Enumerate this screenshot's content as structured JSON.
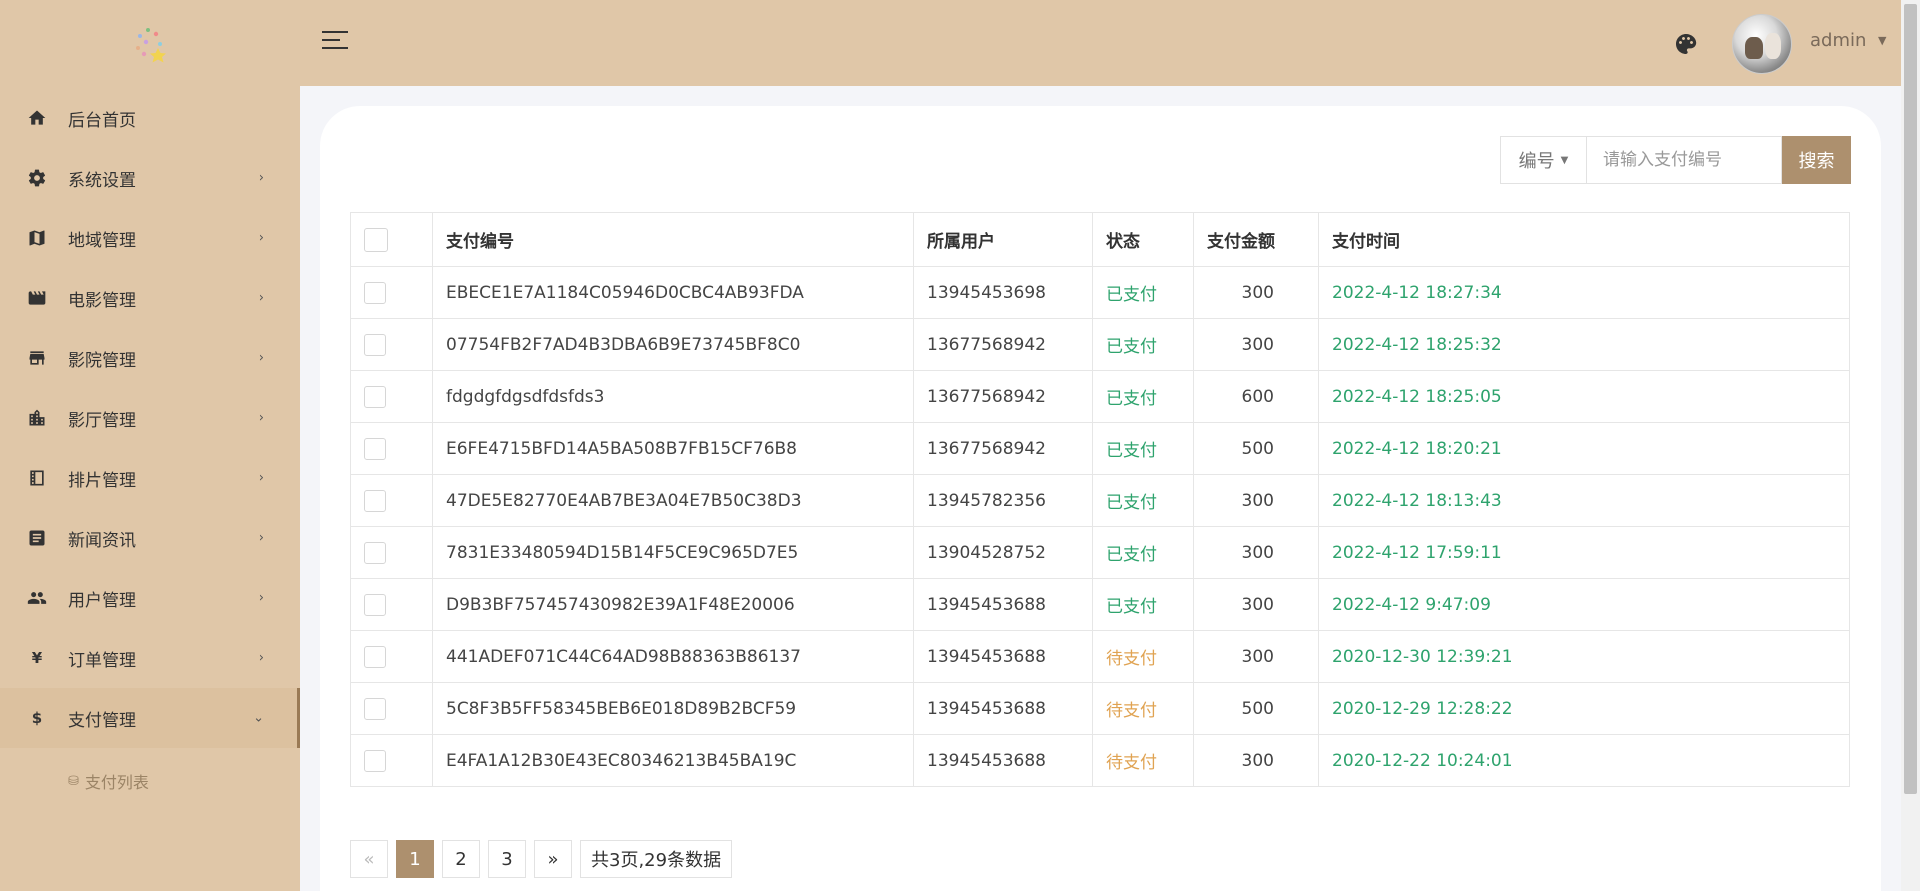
{
  "sidebar": {
    "items": [
      {
        "label": "后台首页",
        "icon": "home-icon",
        "has_children": false
      },
      {
        "label": "系统设置",
        "icon": "gear-icon",
        "has_children": true
      },
      {
        "label": "地域管理",
        "icon": "map-icon",
        "has_children": true
      },
      {
        "label": "电影管理",
        "icon": "film-icon",
        "has_children": true
      },
      {
        "label": "影院管理",
        "icon": "store-icon",
        "has_children": true
      },
      {
        "label": "影厅管理",
        "icon": "building-icon",
        "has_children": true
      },
      {
        "label": "排片管理",
        "icon": "schedule-icon",
        "has_children": true
      },
      {
        "label": "新闻资讯",
        "icon": "news-icon",
        "has_children": true
      },
      {
        "label": "用户管理",
        "icon": "users-icon",
        "has_children": true
      },
      {
        "label": "订单管理",
        "icon": "yen-icon",
        "has_children": true
      },
      {
        "label": "支付管理",
        "icon": "dollar-icon",
        "has_children": true,
        "expanded": true
      }
    ],
    "sub_items": [
      {
        "label": "支付列表",
        "icon": "database-icon"
      }
    ]
  },
  "header": {
    "user_name": "admin",
    "icons": [
      "hamburger-icon",
      "palette-icon"
    ]
  },
  "search": {
    "field_select": "编号",
    "placeholder": "请输入支付编号",
    "button_label": "搜索"
  },
  "table": {
    "columns": [
      "支付编号",
      "所属用户",
      "状态",
      "支付金额",
      "支付时间"
    ],
    "rows": [
      {
        "id": "EBECE1E7A1184C05946D0CBC4AB93FDA",
        "user": "13945453698",
        "status": "已支付",
        "amount": "300",
        "time": "2022-4-12 18:27:34"
      },
      {
        "id": "07754FB2F7AD4B3DBA6B9E73745BF8C0",
        "user": "13677568942",
        "status": "已支付",
        "amount": "300",
        "time": "2022-4-12 18:25:32"
      },
      {
        "id": "fdgdgfdgsdfdsfds3",
        "user": "13677568942",
        "status": "已支付",
        "amount": "600",
        "time": "2022-4-12 18:25:05"
      },
      {
        "id": "E6FE4715BFD14A5BA508B7FB15CF76B8",
        "user": "13677568942",
        "status": "已支付",
        "amount": "500",
        "time": "2022-4-12 18:20:21"
      },
      {
        "id": "47DE5E82770E4AB7BE3A04E7B50C38D3",
        "user": "13945782356",
        "status": "已支付",
        "amount": "300",
        "time": "2022-4-12 18:13:43"
      },
      {
        "id": "7831E33480594D15B14F5CE9C965D7E5",
        "user": "13904528752",
        "status": "已支付",
        "amount": "300",
        "time": "2022-4-12 17:59:11"
      },
      {
        "id": "D9B3BF757457430982E39A1F48E20006",
        "user": "13945453688",
        "status": "已支付",
        "amount": "300",
        "time": "2022-4-12 9:47:09"
      },
      {
        "id": "441ADEF071C44C64AD98B88363B86137",
        "user": "13945453688",
        "status": "待支付",
        "amount": "300",
        "time": "2020-12-30 12:39:21"
      },
      {
        "id": "5C8F3B5FF58345BEB6E018D89B2BCF59",
        "user": "13945453688",
        "status": "待支付",
        "amount": "500",
        "time": "2020-12-29 12:28:22"
      },
      {
        "id": "E4FA1A12B30E43EC80346213B45BA19C",
        "user": "13945453688",
        "status": "待支付",
        "amount": "300",
        "time": "2020-12-22 10:24:01"
      }
    ]
  },
  "pagination": {
    "prev": "«",
    "pages": [
      "1",
      "2",
      "3"
    ],
    "current": "1",
    "next": "»",
    "summary": "共3页,29条数据"
  },
  "colors": {
    "sidebar_bg": "#e0c7a8",
    "accent": "#ad906e",
    "paid": "#2ea36d",
    "unpaid": "#e0a352"
  }
}
